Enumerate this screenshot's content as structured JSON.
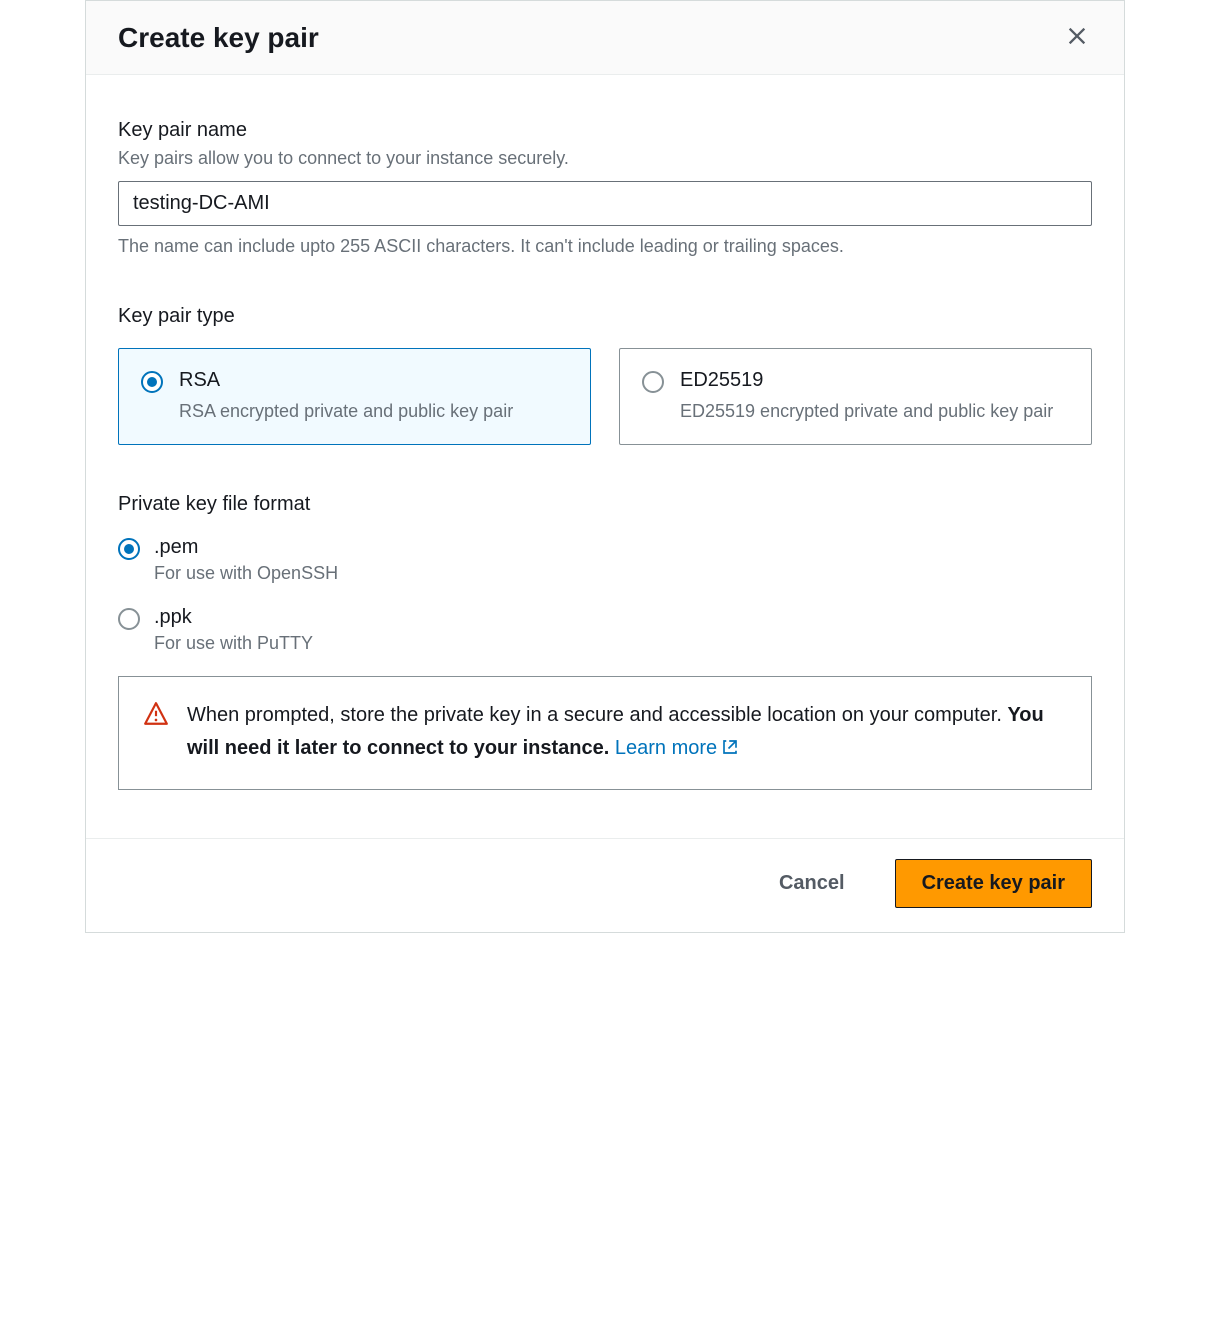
{
  "header": {
    "title": "Create key pair"
  },
  "name_section": {
    "label": "Key pair name",
    "help": "Key pairs allow you to connect to your instance securely.",
    "value": "testing-DC-AMI",
    "hint": "The name can include upto 255 ASCII characters. It can't include leading or trailing spaces."
  },
  "type_section": {
    "label": "Key pair type",
    "options": [
      {
        "title": "RSA",
        "desc": "RSA encrypted private and public key pair",
        "selected": true
      },
      {
        "title": "ED25519",
        "desc": "ED25519 encrypted private and public key pair",
        "selected": false
      }
    ]
  },
  "format_section": {
    "label": "Private key file format",
    "options": [
      {
        "title": ".pem",
        "desc": "For use with OpenSSH",
        "selected": true
      },
      {
        "title": ".ppk",
        "desc": "For use with PuTTY",
        "selected": false
      }
    ]
  },
  "alert": {
    "text_part1": "When prompted, store the private key in a secure and accessible location on your computer. ",
    "text_bold": "You will need it later to connect to your instance.",
    "link_text": "Learn more"
  },
  "footer": {
    "cancel": "Cancel",
    "submit": "Create key pair"
  }
}
